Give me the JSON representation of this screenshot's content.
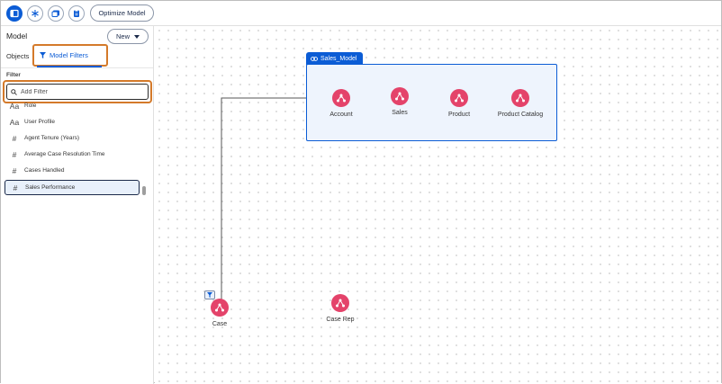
{
  "toolbar": {
    "optimize_label": "Optimize Model",
    "icons": [
      "panel-icon",
      "snowflake-icon",
      "image-icon",
      "clipboard-icon"
    ]
  },
  "left_panel": {
    "title": "Model",
    "new_label": "New",
    "tabs": [
      {
        "label": "Objects"
      },
      {
        "label": "Model Filters"
      }
    ],
    "filter_label": "Filter",
    "search_placeholder": "Add Filter",
    "fields": [
      {
        "type": "text",
        "icon": "Aa",
        "label": "Role"
      },
      {
        "type": "text",
        "icon": "Aa",
        "label": "User Profile"
      },
      {
        "type": "number",
        "icon": "#",
        "label": "Agent Tenure (Years)"
      },
      {
        "type": "number",
        "icon": "#",
        "label": "Average Case Resolution Time"
      },
      {
        "type": "number",
        "icon": "#",
        "label": "Cases Handled"
      },
      {
        "type": "number",
        "icon": "#",
        "label": "Sales Performance",
        "selected": true
      }
    ]
  },
  "canvas": {
    "model_name": "Sales_Model",
    "model_nodes": [
      {
        "label": "Account"
      },
      {
        "label": "Sales"
      },
      {
        "label": "Product"
      },
      {
        "label": "Product Catalog"
      }
    ],
    "outside_nodes": [
      {
        "label": "Case"
      },
      {
        "label": "Case Rep"
      }
    ]
  },
  "colors": {
    "accent": "#0b5cd5",
    "node": "#e4436a",
    "highlight": "#d47a2a"
  }
}
